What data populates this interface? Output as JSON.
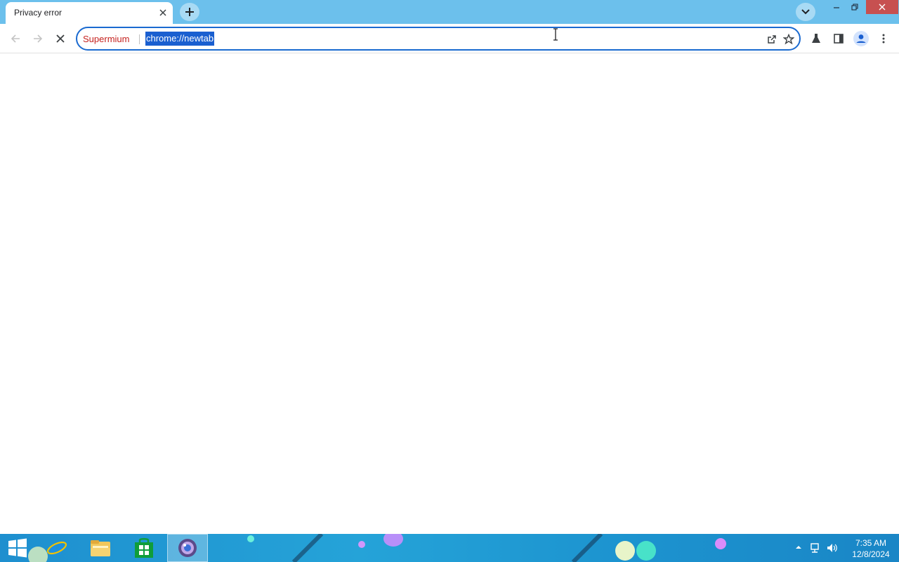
{
  "tab": {
    "title": "Privacy error",
    "close_icon": "close-icon"
  },
  "tabstrip": {
    "new_tab_icon": "plus-icon",
    "tab_search_icon": "chevron-down-icon"
  },
  "window_controls": {
    "minimize_icon": "minimize-icon",
    "restore_icon": "restore-icon",
    "close_icon": "close-icon"
  },
  "toolbar": {
    "back_icon": "back-arrow-icon",
    "forward_icon": "forward-arrow-icon",
    "stop_icon": "stop-icon",
    "omnibox": {
      "origin_label": "Supermium",
      "url": "chrome://newtab"
    },
    "share_icon": "share-icon",
    "bookmark_icon": "star-icon",
    "labs_icon": "flask-icon",
    "side_panel_icon": "side-panel-icon",
    "profile_icon": "profile-icon",
    "menu_icon": "kebab-menu-icon"
  },
  "taskbar": {
    "apps": [
      "start",
      "internet-explorer",
      "file-explorer",
      "store",
      "supermium"
    ],
    "time": "7:35 AM",
    "date": "12/8/2024"
  },
  "colors": {
    "accent": "#1a6ad0",
    "tabstrip": "#6cc0ec",
    "origin": "#c5221f",
    "close_button": "#c75050"
  }
}
